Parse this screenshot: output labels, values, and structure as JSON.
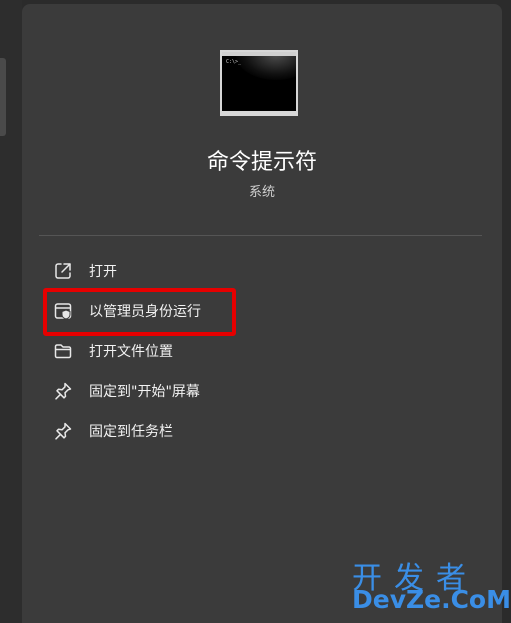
{
  "app": {
    "name": "命令提示符",
    "category": "系统",
    "icon": "command-prompt-icon"
  },
  "menu": {
    "items": [
      {
        "label": "打开",
        "icon": "open-external-icon"
      },
      {
        "label": "以管理员身份运行",
        "icon": "run-as-admin-shield-icon"
      },
      {
        "label": "打开文件位置",
        "icon": "folder-icon"
      },
      {
        "label": "固定到\"开始\"屏幕",
        "icon": "pin-icon"
      },
      {
        "label": "固定到任务栏",
        "icon": "pin-icon"
      }
    ]
  },
  "annotation": {
    "highlighted_item": "以管理员身份运行",
    "color": "#e60000"
  },
  "watermark": {
    "line1": "开发者",
    "line2": "DevZe.CoM"
  },
  "colors": {
    "panel": "#3b3b3b",
    "background": "#2b2b2b",
    "text": "#f2f2f2",
    "watermark": "#3a8ee6"
  }
}
